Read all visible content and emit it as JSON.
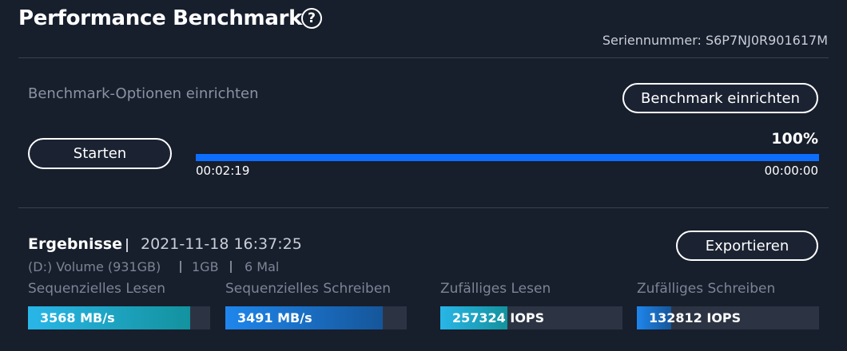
{
  "header": {
    "title": "Performance Benchmark",
    "help_icon": "?",
    "serial": "Seriennummer: S6P7NJ0R901617M"
  },
  "options": {
    "label": "Benchmark-Optionen einrichten",
    "setup_button": "Benchmark einrichten"
  },
  "run": {
    "start_button": "Starten",
    "progress_percent": 100,
    "progress_label": "100%",
    "elapsed": "00:02:19",
    "remaining": "00:00:00"
  },
  "results": {
    "title": "Ergebnisse",
    "datetime": "2021-11-18 16:37:25",
    "volume": "(D:) Volume (931GB)",
    "size": "1GB",
    "runs": "6 Mal",
    "export_button": "Exportieren",
    "metrics": [
      {
        "label": "Sequenzielles Lesen",
        "value": "3568 MB/s",
        "fill": 0.89,
        "gradient": "linear-gradient(90deg,#29b6e8,#13929e)"
      },
      {
        "label": "Sequenzielles Schreiben",
        "value": "3491 MB/s",
        "fill": 0.87,
        "gradient": "linear-gradient(90deg,#1f86ec,#15569a)"
      },
      {
        "label": "Zufälliges Lesen",
        "value": "257324 IOPS",
        "fill": 0.37,
        "gradient": "linear-gradient(90deg,#29b6e8,#13929e)"
      },
      {
        "label": "Zufälliges Schreiben",
        "value": "132812 IOPS",
        "fill": 0.19,
        "gradient": "linear-gradient(90deg,#1f86ec,#15569a)"
      }
    ]
  },
  "colors": {
    "background": "#171e2c",
    "accent": "#0d6efd",
    "track": "#2c3444"
  }
}
